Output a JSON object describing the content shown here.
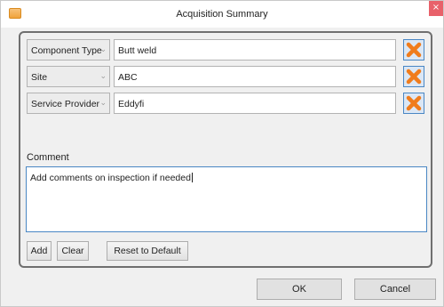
{
  "window": {
    "title": "Acquisition Summary",
    "close_glyph": "×"
  },
  "fields": [
    {
      "label": "Component Type",
      "value": "Butt weld"
    },
    {
      "label": "Site",
      "value": "ABC"
    },
    {
      "label": "Service Provider",
      "value": "Eddyfi"
    }
  ],
  "combo_caret": "⌄",
  "comment": {
    "label": "Comment",
    "text": "Add comments on inspection if needed"
  },
  "actions": {
    "add": "Add",
    "clear": "Clear",
    "reset": "Reset to Default"
  },
  "footer": {
    "ok": "OK",
    "cancel": "Cancel"
  },
  "colors": {
    "remove_icon": "#f07c1c",
    "focus_border": "#4a87c4"
  },
  "icons": {
    "remove": "remove-x-icon",
    "app": "app-icon"
  }
}
